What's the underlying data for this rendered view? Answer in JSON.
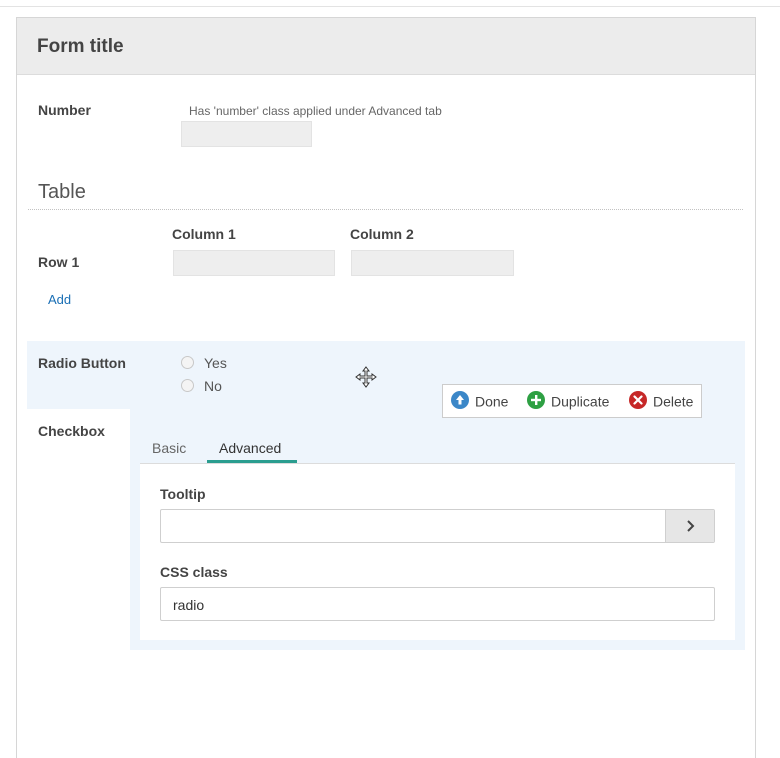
{
  "form": {
    "title": "Form title"
  },
  "number_field": {
    "label": "Number",
    "help": "Has 'number' class applied under Advanced tab"
  },
  "table": {
    "title": "Table",
    "columns": [
      "Column 1",
      "Column 2"
    ],
    "rows": [
      "Row 1"
    ],
    "add_label": "Add"
  },
  "radio": {
    "label": "Radio Button",
    "options": [
      "Yes",
      "No"
    ]
  },
  "checkbox": {
    "label": "Checkbox"
  },
  "actions": {
    "done": "Done",
    "duplicate": "Duplicate",
    "delete": "Delete"
  },
  "editor": {
    "tabs": [
      "Basic",
      "Advanced"
    ],
    "active_tab": "Advanced",
    "tooltip": {
      "label": "Tooltip",
      "value": ""
    },
    "css_class": {
      "label": "CSS class",
      "value": "radio"
    }
  },
  "colors": {
    "accent": "#2a9d8f",
    "done": "#3b87c8",
    "duplicate": "#2ea043",
    "delete": "#c62828",
    "selected_bg": "#eef5fc"
  },
  "icons": [
    "move-icon",
    "arrow-up-icon",
    "plus-icon",
    "close-icon",
    "chevron-right-icon"
  ]
}
